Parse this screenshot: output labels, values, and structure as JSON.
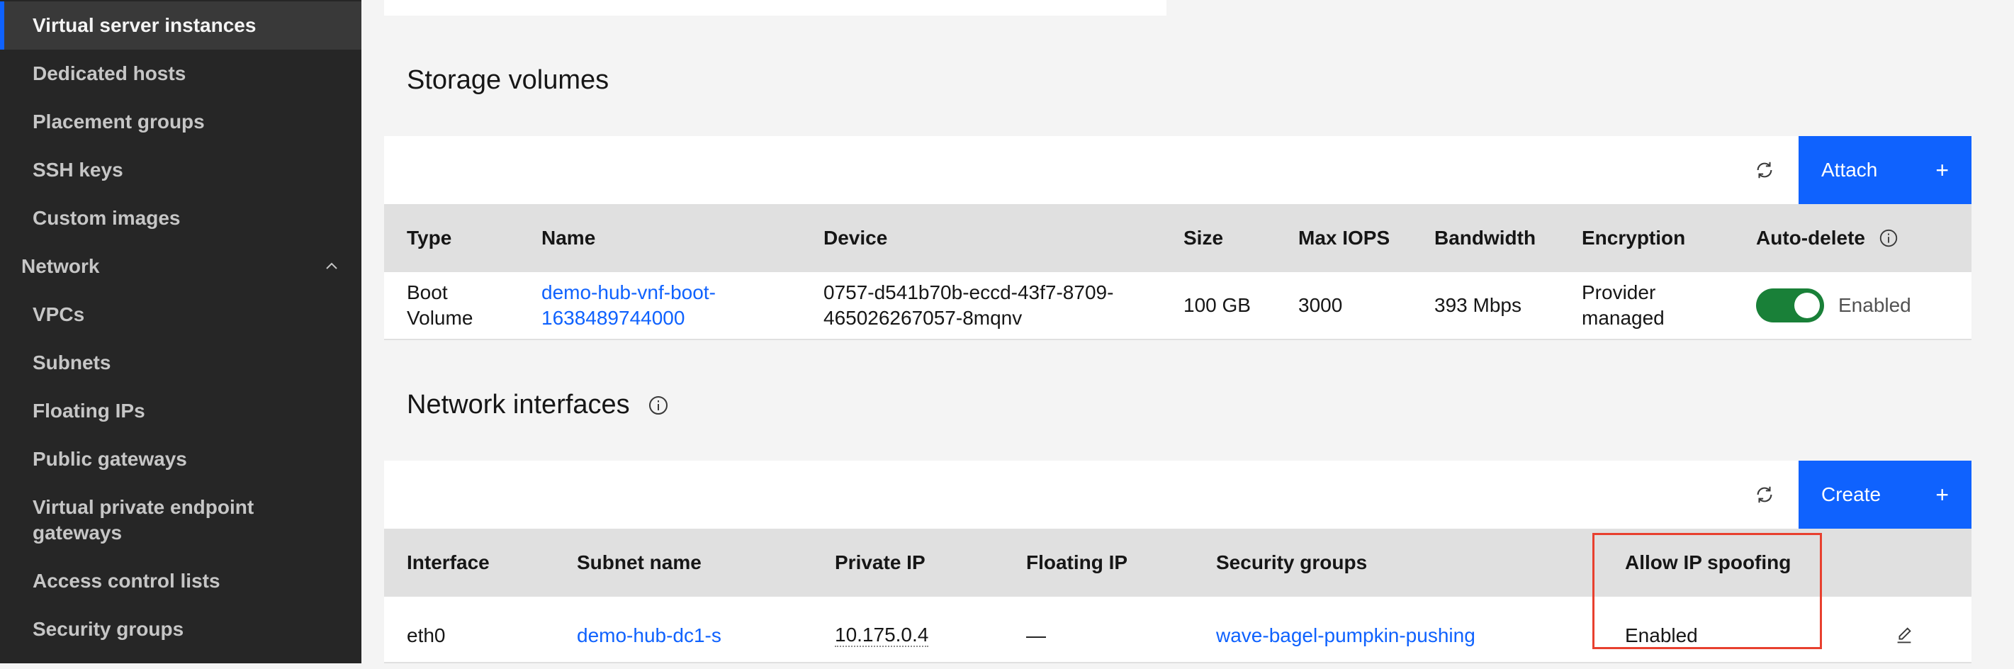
{
  "sidebar": {
    "items": [
      {
        "label": "Virtual server instances",
        "active": true
      },
      {
        "label": "Dedicated hosts"
      },
      {
        "label": "Placement groups"
      },
      {
        "label": "SSH keys"
      },
      {
        "label": "Custom images"
      }
    ],
    "network_group": {
      "label": "Network",
      "expanded": true
    },
    "network_items": [
      {
        "label": "VPCs"
      },
      {
        "label": "Subnets"
      },
      {
        "label": "Floating IPs"
      },
      {
        "label": "Public gateways"
      },
      {
        "label": "Virtual private endpoint gateways"
      },
      {
        "label": "Access control lists"
      },
      {
        "label": "Security groups"
      }
    ]
  },
  "storage": {
    "title": "Storage volumes",
    "attach_label": "Attach",
    "columns": [
      "Type",
      "Name",
      "Device",
      "Size",
      "Max IOPS",
      "Bandwidth",
      "Encryption",
      "Auto-delete"
    ],
    "row": {
      "type": "Boot Volume",
      "name": "demo-hub-vnf-boot-1638489744000",
      "device": "0757-d541b70b-eccd-43f7-8709-465026267057-8mqnv",
      "size": "100 GB",
      "max_iops": "3000",
      "bandwidth": "393 Mbps",
      "encryption": "Provider managed",
      "auto_delete": "Enabled"
    }
  },
  "network": {
    "title": "Network interfaces",
    "create_label": "Create",
    "columns": [
      "Interface",
      "Subnet name",
      "Private IP",
      "Floating IP",
      "Security groups",
      "Allow IP spoofing"
    ],
    "row": {
      "interface": "eth0",
      "subnet": "demo-hub-dc1-s",
      "private_ip": "10.175.0.4",
      "floating_ip": "—",
      "security_groups": "wave-bagel-pumpkin-pushing",
      "ip_spoofing": "Enabled"
    }
  },
  "icons": {
    "refresh": "refresh-icon",
    "plus": "plus-icon",
    "info": "info-icon",
    "edit": "edit-icon",
    "chevron": "chevron-up-icon"
  },
  "colors": {
    "accent": "#0f62fe",
    "toggle_on": "#198038",
    "highlight": "#e8402f",
    "sidebar_bg": "#262626"
  }
}
